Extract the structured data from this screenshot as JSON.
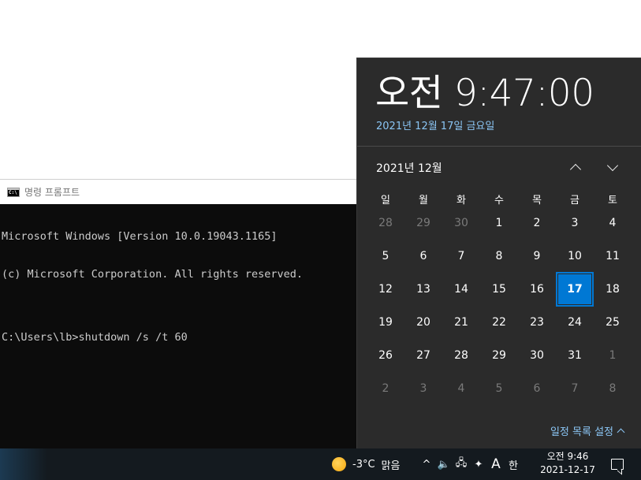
{
  "cmd": {
    "title": "명령 프롬프트",
    "lines": [
      "Microsoft Windows [Version 10.0.19043.1165]",
      "(c) Microsoft Corporation. All rights reserved.",
      "",
      "C:\\Users\\lb>shutdown /s /t 60"
    ]
  },
  "flyout": {
    "time": "오전 9:47:00",
    "date": "2021년 12월 17일 금요일",
    "month": "2021년 12월",
    "weekdays": [
      "일",
      "월",
      "화",
      "수",
      "목",
      "금",
      "토"
    ],
    "weeks": [
      [
        {
          "d": "28",
          "dim": true
        },
        {
          "d": "29",
          "dim": true
        },
        {
          "d": "30",
          "dim": true
        },
        {
          "d": "1"
        },
        {
          "d": "2"
        },
        {
          "d": "3"
        },
        {
          "d": "4"
        }
      ],
      [
        {
          "d": "5"
        },
        {
          "d": "6"
        },
        {
          "d": "7"
        },
        {
          "d": "8"
        },
        {
          "d": "9"
        },
        {
          "d": "10"
        },
        {
          "d": "11"
        }
      ],
      [
        {
          "d": "12"
        },
        {
          "d": "13"
        },
        {
          "d": "14"
        },
        {
          "d": "15"
        },
        {
          "d": "16"
        },
        {
          "d": "17",
          "today": true
        },
        {
          "d": "18"
        }
      ],
      [
        {
          "d": "19"
        },
        {
          "d": "20"
        },
        {
          "d": "21"
        },
        {
          "d": "22"
        },
        {
          "d": "23"
        },
        {
          "d": "24"
        },
        {
          "d": "25"
        }
      ],
      [
        {
          "d": "26"
        },
        {
          "d": "27"
        },
        {
          "d": "28"
        },
        {
          "d": "29"
        },
        {
          "d": "30"
        },
        {
          "d": "31"
        },
        {
          "d": "1",
          "dim": true
        }
      ],
      [
        {
          "d": "2",
          "dim": true
        },
        {
          "d": "3",
          "dim": true
        },
        {
          "d": "4",
          "dim": true
        },
        {
          "d": "5",
          "dim": true
        },
        {
          "d": "6",
          "dim": true
        },
        {
          "d": "7",
          "dim": true
        },
        {
          "d": "8",
          "dim": true
        }
      ]
    ],
    "footer": "일정 목록 설정"
  },
  "taskbar": {
    "weather_temp": "-3°C",
    "weather_desc": "맑음",
    "tray_icons": [
      {
        "name": "chevron-up-icon",
        "glyph": "^"
      },
      {
        "name": "speaker-icon",
        "glyph": "🔈"
      },
      {
        "name": "network-icon",
        "glyph": "🖧"
      },
      {
        "name": "dropbox-icon",
        "glyph": "✦"
      },
      {
        "name": "ime-mode-icon",
        "glyph": "A"
      },
      {
        "name": "ime-korean-icon",
        "glyph": "한"
      }
    ],
    "clock_time": "오전 9:46",
    "clock_date": "2021-12-17"
  },
  "colors": {
    "accent": "#0078d4",
    "link": "#8bc6f5",
    "flyout_bg": "#2b2b2b",
    "taskbar_bg": "#141a1f",
    "console_bg": "#0c0c0c"
  }
}
